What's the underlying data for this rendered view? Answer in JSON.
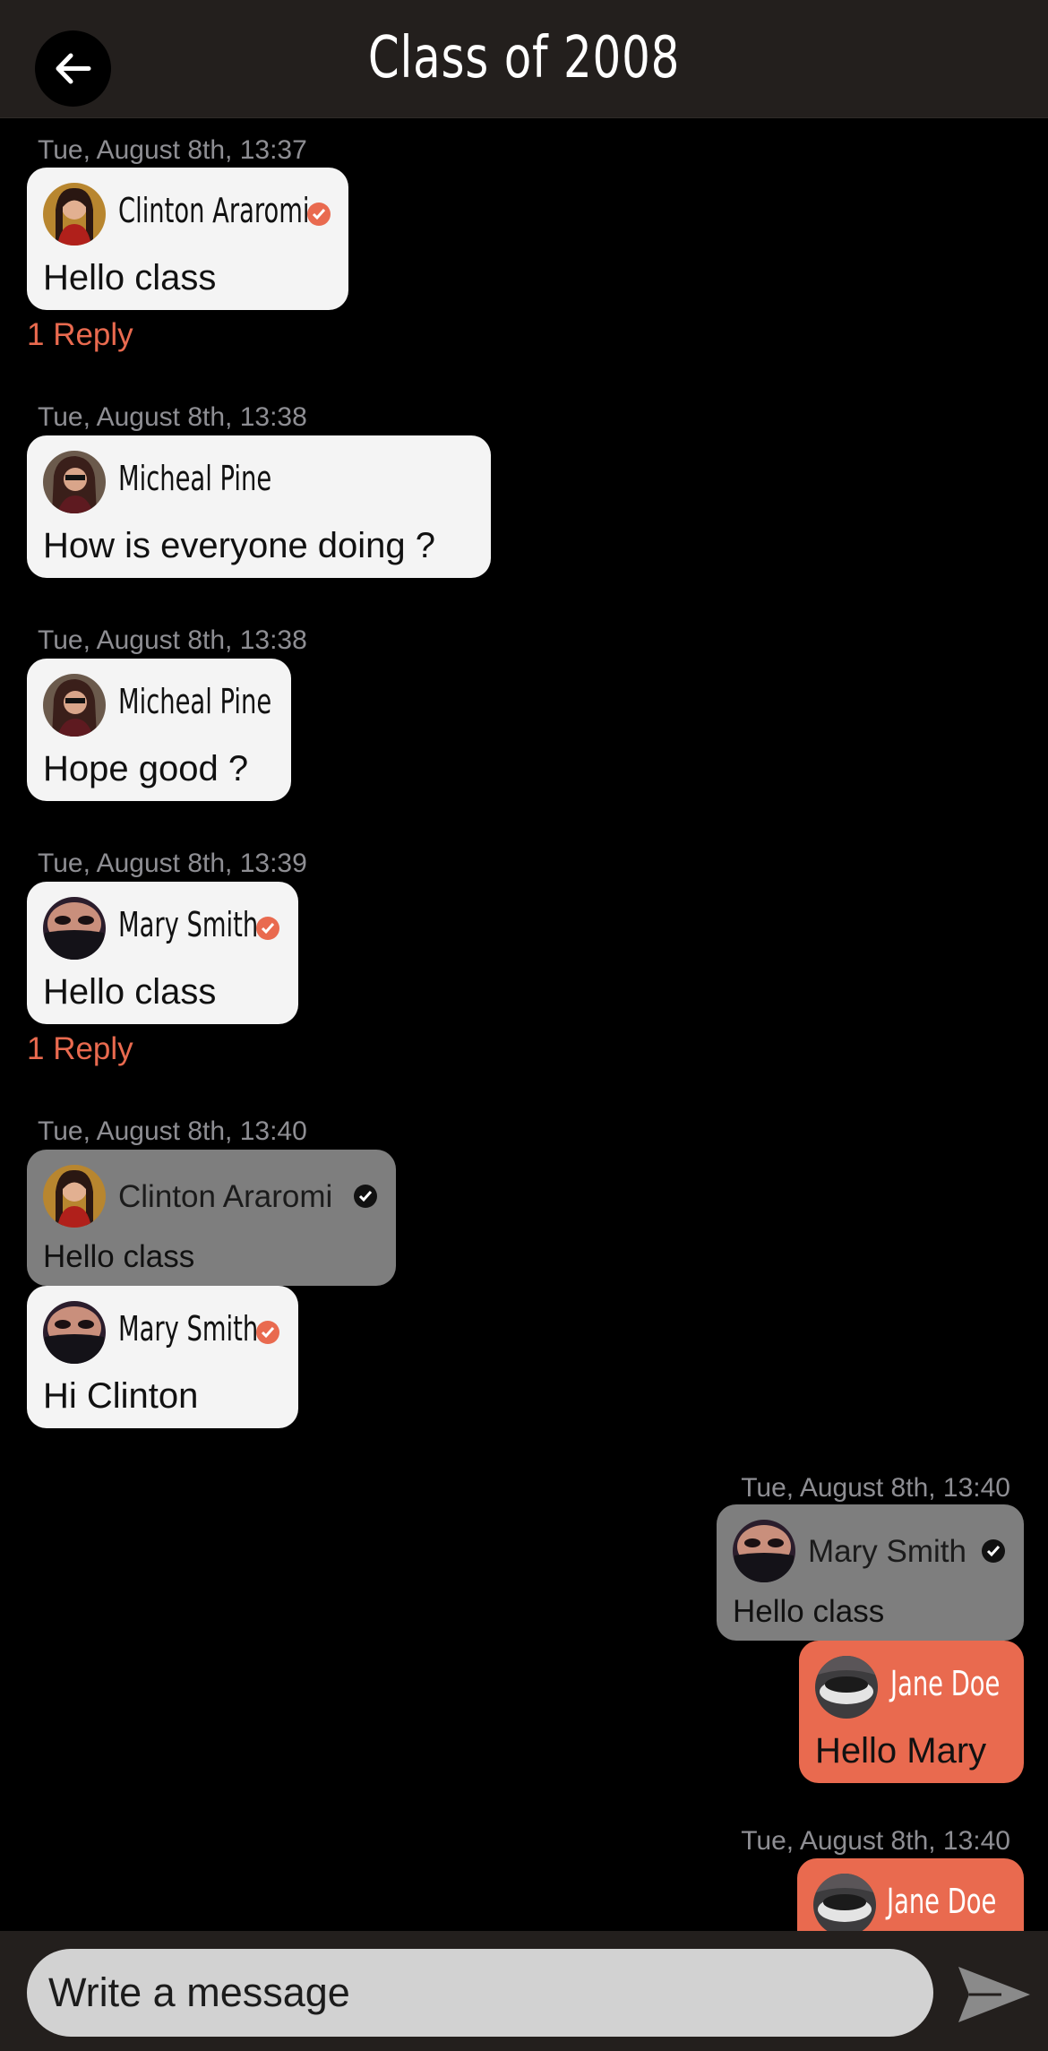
{
  "header": {
    "title": "Class of 2008"
  },
  "messages": [
    {
      "timestamp": "Tue, August 8th, 13:37",
      "author": "Clinton Araromi",
      "text": "Hello class",
      "reply": "1 Reply"
    },
    {
      "timestamp": "Tue, August 8th, 13:38",
      "author": "Micheal Pine",
      "text": "How is everyone doing ?"
    },
    {
      "timestamp": "Tue, August 8th, 13:38",
      "author": "Micheal Pine",
      "text": "Hope good ?"
    },
    {
      "timestamp": "Tue, August 8th, 13:39",
      "author": "Mary Smith",
      "text": "Hello class",
      "reply": "1 Reply"
    },
    {
      "timestamp": "Tue, August 8th, 13:40",
      "quote": {
        "author": "Clinton Araromi",
        "text": "Hello class"
      },
      "author": "Mary Smith",
      "text": "Hi Clinton"
    },
    {
      "timestamp": "Tue, August 8th, 13:40",
      "quote": {
        "author": "Mary Smith",
        "text": "Hello class"
      },
      "author": "Jane Doe",
      "text": "Hello Mary"
    },
    {
      "timestamp": "Tue, August 8th, 13:40",
      "author": "Jane Doe"
    }
  ],
  "composer": {
    "placeholder": "Write a message"
  },
  "colors": {
    "accent": "#e96a4f",
    "header": "#231f1d",
    "bubble": "#f4f4f4",
    "quoted": "#7e7e7e",
    "input": "#d2d2d2"
  }
}
